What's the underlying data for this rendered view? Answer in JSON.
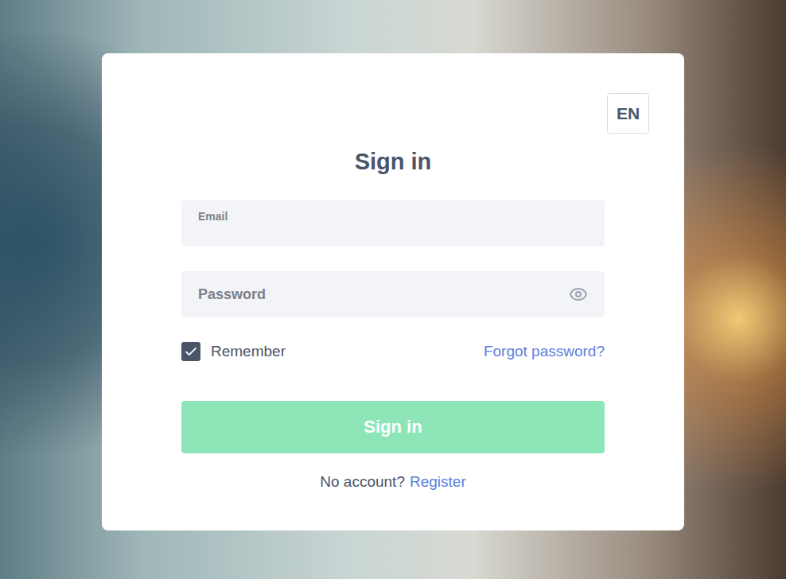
{
  "language": {
    "label": "EN"
  },
  "title": "Sign in",
  "fields": [
    {
      "label": "Email",
      "kind": "label",
      "type": "email"
    },
    {
      "label": "Password",
      "kind": "placeholder",
      "type": "password"
    }
  ],
  "remember": {
    "label": "Remember",
    "checked": true
  },
  "forgot": "Forgot password?",
  "submit": {
    "label": "Sign in",
    "disabled": true
  },
  "footer": {
    "text": "No account?",
    "link": "Register"
  }
}
